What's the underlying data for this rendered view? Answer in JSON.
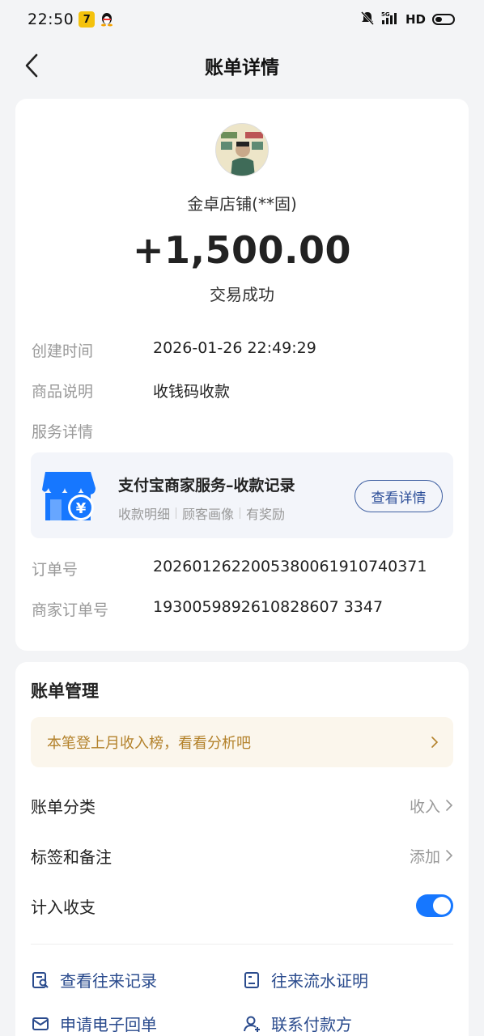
{
  "status_bar": {
    "time": "22:50",
    "network": "5G",
    "hd": "HD"
  },
  "header": {
    "title": "账单详情"
  },
  "bill": {
    "merchant": "金卓店铺(**固)",
    "amount": "+1,500.00",
    "status": "交易成功",
    "rows": [
      {
        "label": "创建时间",
        "value": "2026-01-26 22:49:29"
      },
      {
        "label": "商品说明",
        "value": "收钱码收款"
      },
      {
        "label": "服务详情",
        "value": ""
      }
    ],
    "service": {
      "title": "支付宝商家服务–收款记录",
      "tags": [
        "收款明细",
        "顾客画像",
        "有奖励"
      ],
      "button": "查看详情"
    },
    "order_rows": [
      {
        "label": "订单号",
        "value": "2026012622005380061910740371"
      },
      {
        "label": "商家订单号",
        "value": "1930059892610828607 3347"
      }
    ]
  },
  "management": {
    "title": "账单管理",
    "promo": "本笔登上月收入榜，看看分析吧",
    "category_label": "账单分类",
    "category_value": "收入",
    "tag_label": "标签和备注",
    "tag_value": "添加",
    "include_label": "计入收支",
    "include_on": true,
    "actions": [
      {
        "label": "查看往来记录",
        "icon": "search-record-icon"
      },
      {
        "label": "往来流水证明",
        "icon": "document-icon"
      },
      {
        "label": "申请电子回单",
        "icon": "mail-icon"
      },
      {
        "label": "联系付款方",
        "icon": "contact-user-icon"
      }
    ]
  },
  "colors": {
    "accent_blue": "#1677ff",
    "link_blue": "#2a4b8d",
    "promo_text": "#b3812a",
    "promo_bg": "#fbf6ec"
  }
}
